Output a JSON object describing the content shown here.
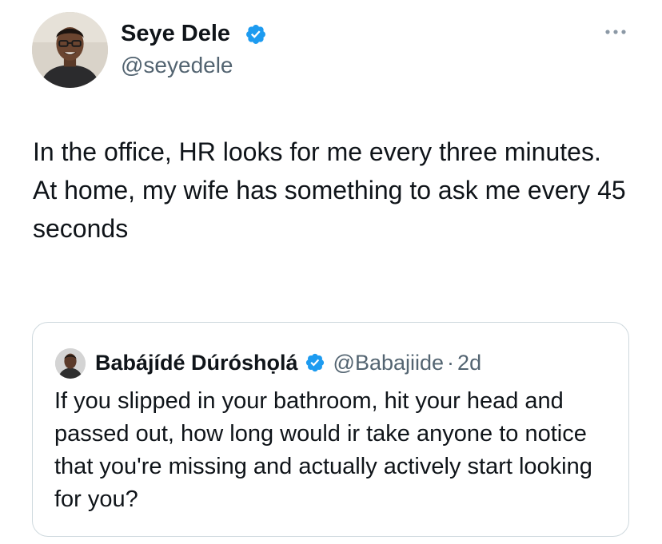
{
  "tweet": {
    "author": {
      "display_name": "Seye Dele",
      "handle": "@seyedele",
      "verified": true,
      "avatar_icon": "profile-photo"
    },
    "more_icon": "more-horizontal-icon",
    "text": "In the office, HR looks for me every three minutes.\nAt home, my wife has something to ask me every 45 seconds"
  },
  "quoted_tweet": {
    "author": {
      "display_name": "Babájídé Dúróshọlá",
      "handle": "@Babajiide",
      "verified": true,
      "avatar_icon": "profile-photo"
    },
    "separator": "·",
    "time": "2d",
    "text": "If you slipped in your bathroom, hit your head and passed out, how long would ir take anyone to notice that you're missing and actually actively start looking for you?"
  },
  "colors": {
    "verified_badge": "#1d9bf0",
    "text_primary": "#0f1419",
    "text_secondary": "#536471",
    "border": "#cfd9de"
  }
}
